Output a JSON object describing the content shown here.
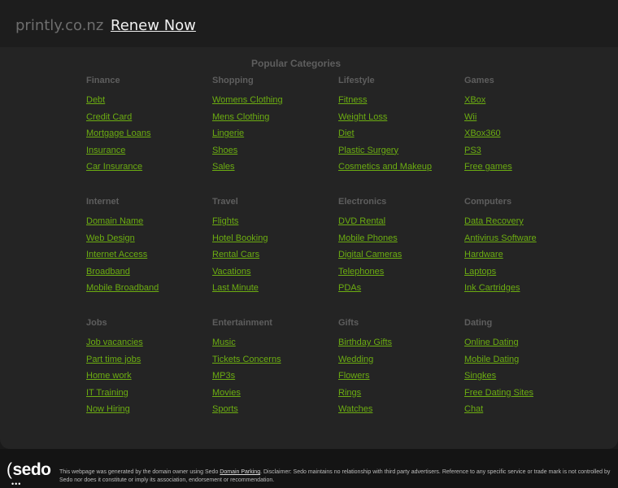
{
  "header": {
    "domain": "printly.co.nz",
    "renew_label": "Renew Now"
  },
  "popular_title": "Popular Categories",
  "categories": [
    {
      "title": "Finance",
      "links": [
        "Debt",
        "Credit Card",
        "Mortgage Loans",
        "Insurance",
        "Car Insurance"
      ]
    },
    {
      "title": "Shopping",
      "links": [
        "Womens Clothing",
        "Mens Clothing",
        "Lingerie",
        "Shoes",
        "Sales"
      ]
    },
    {
      "title": "Lifestyle",
      "links": [
        "Fitness",
        "Weight Loss",
        "Diet",
        "Plastic Surgery",
        "Cosmetics and Makeup"
      ]
    },
    {
      "title": "Games",
      "links": [
        "XBox",
        "Wii",
        "XBox360",
        "PS3",
        "Free games"
      ]
    },
    {
      "title": "Internet",
      "links": [
        "Domain Name",
        "Web Design",
        "Internet Access",
        "Broadband",
        "Mobile Broadband"
      ]
    },
    {
      "title": "Travel",
      "links": [
        "Flights",
        "Hotel Booking",
        "Rental Cars",
        "Vacations",
        "Last Minute"
      ]
    },
    {
      "title": "Electronics",
      "links": [
        "DVD Rental",
        "Mobile Phones",
        "Digital Cameras",
        "Telephones",
        "PDAs"
      ]
    },
    {
      "title": "Computers",
      "links": [
        "Data Recovery",
        "Antivirus Software",
        "Hardware",
        "Laptops",
        "Ink Cartridges"
      ]
    },
    {
      "title": "Jobs",
      "links": [
        "Job vacancies",
        "Part time jobs",
        "Home work",
        "IT Training",
        "Now Hiring"
      ]
    },
    {
      "title": "Entertainment",
      "links": [
        "Music",
        "Tickets Concerns",
        "MP3s",
        "Movies",
        "Sports"
      ]
    },
    {
      "title": "Gifts",
      "links": [
        "Birthday Gifts",
        "Wedding",
        "Flowers",
        "Rings",
        "Watches"
      ]
    },
    {
      "title": "Dating",
      "links": [
        "Online Dating",
        "Mobile Dating",
        "Singkes",
        "Free Dating Sites",
        "Chat"
      ]
    }
  ],
  "footer": {
    "logo_text": "sedo",
    "disclaimer_before": "This webpage was generated by the domain owner using Sedo ",
    "disclaimer_link": "Domain Parking",
    "disclaimer_after": ". Disclaimer: Sedo maintains no relationship with third party advertisers. Reference to any specific service or trade mark is not controlled by Sedo nor does it constitute or imply its association, endorsement or recommendation."
  },
  "colors": {
    "background": "#1a1a1a",
    "panel": "#242424",
    "link": "#6cad11",
    "category_title": "#5e5e5e"
  }
}
